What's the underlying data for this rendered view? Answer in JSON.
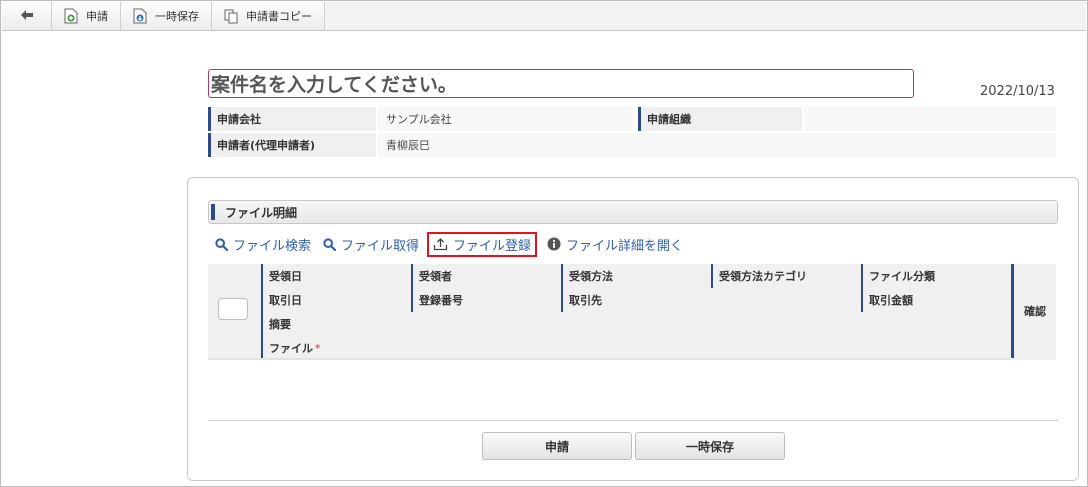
{
  "toolbar": {
    "back_icon": "back-arrow-icon",
    "apply_label": "申請",
    "temp_save_label": "一時保存",
    "copy_label": "申請書コピー"
  },
  "header": {
    "title_placeholder": "案件名を入力してください。",
    "date": "2022/10/13"
  },
  "info": {
    "company_label": "申請会社",
    "company_value": "サンプル会社",
    "org_label": "申請組織",
    "org_value": "",
    "applicant_label": "申請者(代理申請者)",
    "applicant_value": "青柳辰巳"
  },
  "section": {
    "title": "ファイル明細",
    "actions": {
      "search": "ファイル検索",
      "fetch": "ファイル取得",
      "register": "ファイル登録",
      "detail": "ファイル詳細を開く"
    }
  },
  "grid": {
    "received_date": "受領日",
    "receiver": "受領者",
    "receive_method": "受領方法",
    "receive_method_category": "受領方法カテゴリ",
    "file_class": "ファイル分類",
    "trade_date": "取引日",
    "reg_number": "登録番号",
    "partner": "取引先",
    "amount": "取引金額",
    "summary": "摘要",
    "file": "ファイル",
    "required_mark": "*",
    "confirm": "確認"
  },
  "footer": {
    "apply_button": "申請",
    "temp_save_button": "一時保存"
  },
  "colors": {
    "accent_blue": "#2f4a8a",
    "link_blue": "#2f5fa8",
    "title_border": "#b03a5b",
    "highlight_red": "#e0141e"
  }
}
